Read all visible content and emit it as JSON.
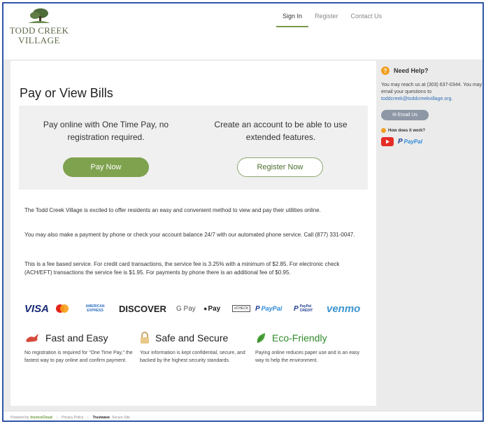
{
  "brand": {
    "line1": "TODD CREEK",
    "line2": "VILLAGE"
  },
  "nav": [
    {
      "label": "Sign In",
      "active": true
    },
    {
      "label": "Register",
      "active": false
    },
    {
      "label": "Contact Us",
      "active": false
    }
  ],
  "main": {
    "title": "Pay or View Bills",
    "left_panel": {
      "text": "Pay online with One Time Pay, no registration required.",
      "button": "Pay Now"
    },
    "right_panel": {
      "text": "Create an account to be able to use extended features.",
      "button": "Register Now"
    },
    "paragraphs": [
      "The Todd Creek Village is excited to offer residents an easy and convenient method to view and pay their utilities online.",
      "You may also make a payment by phone or check your account balance 24/7 with our automated phone service. Call (877) 331-0047.",
      "This is a fee based service. For credit card transactions, the service fee is 3.25% with a minimum of $2.85. For electronic check (ACH/EFT) transactions the service fee is $1.95. For payments by phone there is an additional fee of $0.95."
    ],
    "payment_methods": {
      "visa": "VISA",
      "amex": "AMERICAN EXPRESS",
      "discover": "DISCOVER",
      "gpay": "G Pay",
      "applepay": "Pay",
      "echeck": "eCHECK",
      "paypal": "PayPal",
      "paypal_credit": "PayPal CREDIT",
      "venmo": "venmo"
    },
    "features": [
      {
        "title": "Fast and Easy",
        "desc": "No registration is required for \"One Time Pay,\" the fastest way to pay online and confirm payment."
      },
      {
        "title": "Safe and Secure",
        "desc": "Your information is kept confidential, secure, and backed by the highest security standards."
      },
      {
        "title": "Eco-Friendly",
        "desc": "Paying online reduces paper use and is an easy way to help the environment."
      }
    ]
  },
  "sidebar": {
    "help_title": "Need Help?",
    "reach_text": "You may reach us at (303) 637-0344. You may email your questions to",
    "email": "toddcreek@toddcreekvillage.org.",
    "email_button": "Email Us",
    "how_title": "How does it work?",
    "paypal": "PayPal"
  },
  "footer": {
    "powered_prefix": "Powered by",
    "powered_brand": "InvoiceCloud",
    "privacy": "Privacy Policy",
    "trustwave": "Trustwave",
    "secure_site": "Secure Site"
  },
  "colors": {
    "accent_green": "#7fa24f",
    "frame_blue": "#2f56a6",
    "help_orange": "#f0a020",
    "link_blue": "#2f6fb5"
  }
}
